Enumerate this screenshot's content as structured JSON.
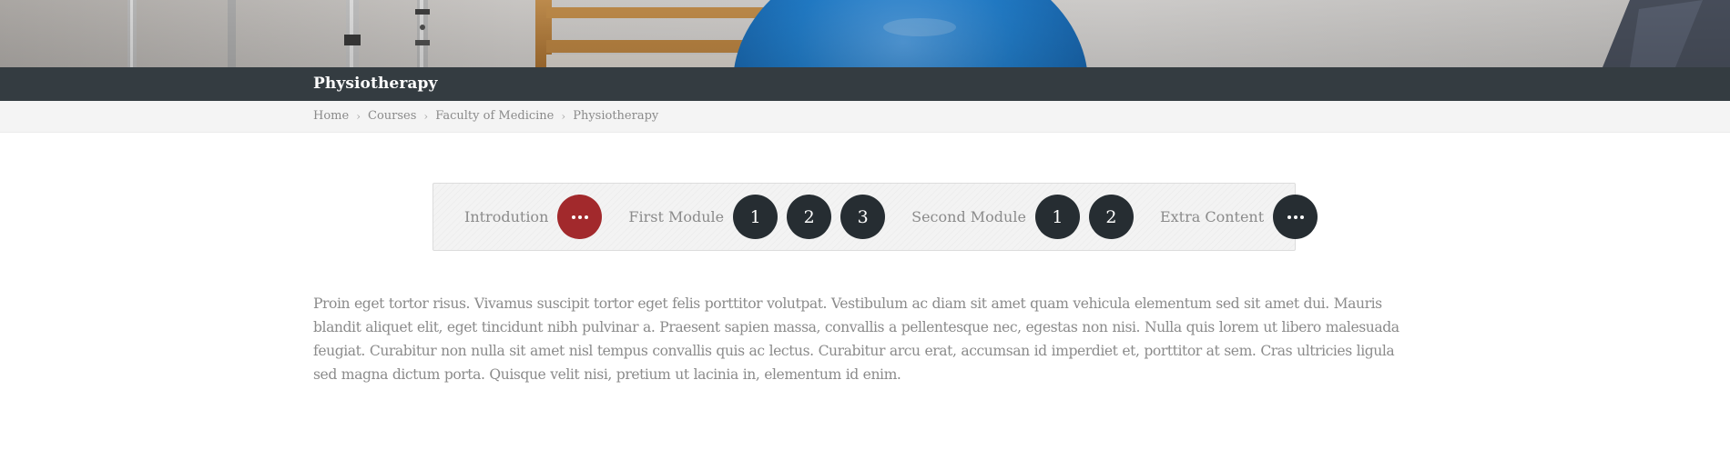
{
  "header": {
    "title": "Physiotherapy"
  },
  "breadcrumb": {
    "items": [
      "Home",
      "Courses",
      "Faculty of Medicine"
    ],
    "current": "Physiotherapy",
    "separator_icon": "chevron-right-icon"
  },
  "module_nav": {
    "groups": [
      {
        "label": "Introdution",
        "buttons": [
          {
            "text": "",
            "icon": "more-dots-icon",
            "active": true
          }
        ]
      },
      {
        "label": "First Module",
        "buttons": [
          {
            "text": "1"
          },
          {
            "text": "2"
          },
          {
            "text": "3"
          }
        ]
      },
      {
        "label": "Second Module",
        "buttons": [
          {
            "text": "1"
          },
          {
            "text": "2"
          }
        ]
      },
      {
        "label": "Extra Content",
        "buttons": [
          {
            "text": "",
            "icon": "more-dots-icon"
          }
        ]
      }
    ]
  },
  "content": {
    "paragraph": "Proin eget tortor risus. Vivamus suscipit tortor eget felis porttitor volutpat. Vestibulum ac diam sit amet quam vehicula elementum sed sit amet dui. Mauris blandit aliquet elit, eget tincidunt nibh pulvinar a. Praesent sapien massa, convallis a pellentesque nec, egestas non nisi. Nulla quis lorem ut libero malesuada feugiat. Curabitur non nulla sit amet nisl tempus convallis quis ac lectus. Curabitur arcu erat, accumsan id imperdiet et, porttitor at sem. Cras ultricies ligula sed magna dictum porta. Quisque velit nisi, pretium ut lacinia in, elementum id enim."
  },
  "colors": {
    "title_bar": "#343c41",
    "breadcrumb_bar": "#f4f4f4",
    "active_button": "#a2292c",
    "button": "#262d32",
    "text": "#8b8b8b"
  }
}
